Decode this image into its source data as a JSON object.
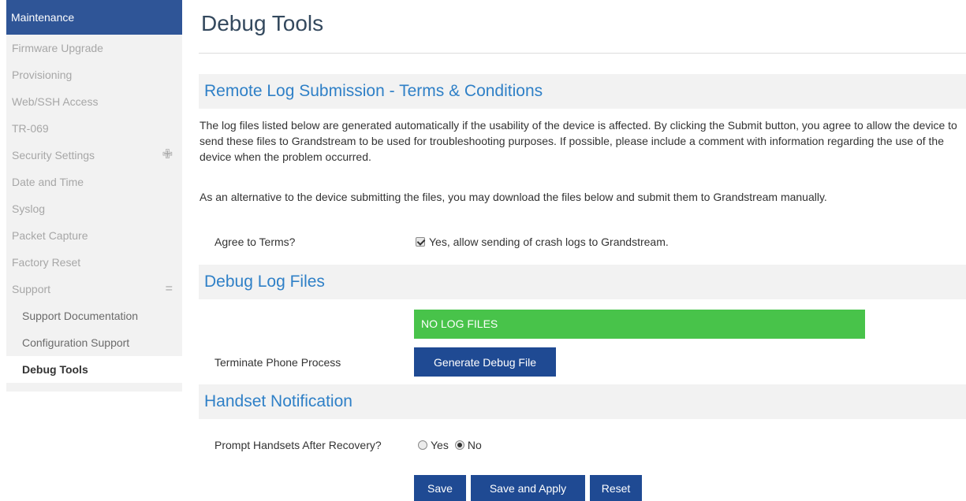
{
  "sidebar": {
    "header": "Maintenance",
    "items": [
      {
        "label": "Firmware Upgrade"
      },
      {
        "label": "Provisioning"
      },
      {
        "label": "Web/SSH Access"
      },
      {
        "label": "TR-069"
      },
      {
        "label": "Security Settings",
        "icon": "plus-icon",
        "icon_glyph": "✙"
      },
      {
        "label": "Date and Time"
      },
      {
        "label": "Syslog"
      },
      {
        "label": "Packet Capture"
      },
      {
        "label": "Factory Reset"
      },
      {
        "label": "Support",
        "icon": "minus-icon",
        "icon_glyph": "="
      }
    ],
    "subitems": [
      {
        "label": "Support Documentation"
      },
      {
        "label": "Configuration Support"
      },
      {
        "label": "Debug Tools",
        "active": true
      }
    ]
  },
  "page": {
    "title": "Debug Tools"
  },
  "remote_log": {
    "heading": "Remote Log Submission - Terms & Conditions",
    "paragraph1": "The log files listed below are generated automatically if the usability of the device is affected. By clicking the Submit button, you agree to allow the device to send these files to Grandstream to be used for troubleshooting purposes. If possible, please include a comment with information regarding the use of the device when the problem occurred.",
    "paragraph2": "As an alternative to the device submitting the files, you may download the files below and submit them to Grandstream manually.",
    "agree_label": "Agree to Terms?",
    "agree_checkbox_label": "Yes, allow sending of crash logs to Grandstream.",
    "agree_checked": true
  },
  "debug_logs": {
    "heading": "Debug Log Files",
    "status_text": "NO LOG FILES",
    "terminate_label": "Terminate Phone Process",
    "generate_button": "Generate Debug File"
  },
  "handset": {
    "heading": "Handset Notification",
    "prompt_label": "Prompt Handsets After Recovery?",
    "options": [
      "Yes",
      "No"
    ],
    "selected": "No"
  },
  "actions": {
    "save": "Save",
    "save_apply": "Save and Apply",
    "reset": "Reset"
  },
  "colors": {
    "sidebar_header": "#2f5597",
    "section_heading": "#2f80c7",
    "status_green": "#48c34a",
    "button_blue": "#1f4a93"
  }
}
